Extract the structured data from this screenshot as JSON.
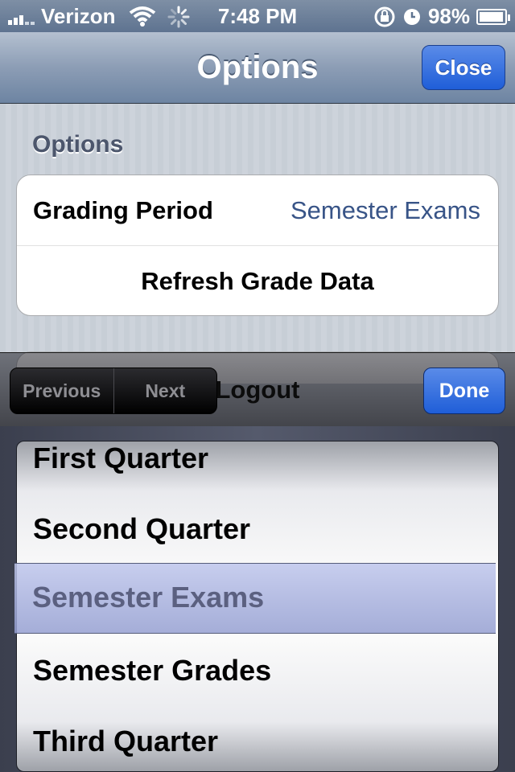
{
  "status_bar": {
    "carrier": "Verizon",
    "time": "7:48 PM",
    "battery": "98%",
    "battery_level": 0.98,
    "icons": [
      "signal-bars-icon",
      "wifi-icon",
      "activity-spinner-icon",
      "rotation-lock-icon",
      "alarm-clock-icon",
      "battery-icon"
    ]
  },
  "navbar": {
    "title": "Options",
    "close_label": "Close"
  },
  "section": {
    "header": "Options",
    "grading_period_label": "Grading Period",
    "grading_period_value": "Semester Exams",
    "refresh_label": "Refresh Grade Data",
    "logout_label": "Logout"
  },
  "toolbar": {
    "previous_label": "Previous",
    "next_label": "Next",
    "done_label": "Done"
  },
  "picker": {
    "items": [
      "First Quarter",
      "Second Quarter",
      "Semester Exams",
      "Semester Grades",
      "Third Quarter"
    ],
    "selected": "Semester Exams"
  },
  "colors": {
    "accent_blue": "#1f5ed8",
    "value_text": "#385487",
    "nav_bar": "#8c9db5"
  }
}
